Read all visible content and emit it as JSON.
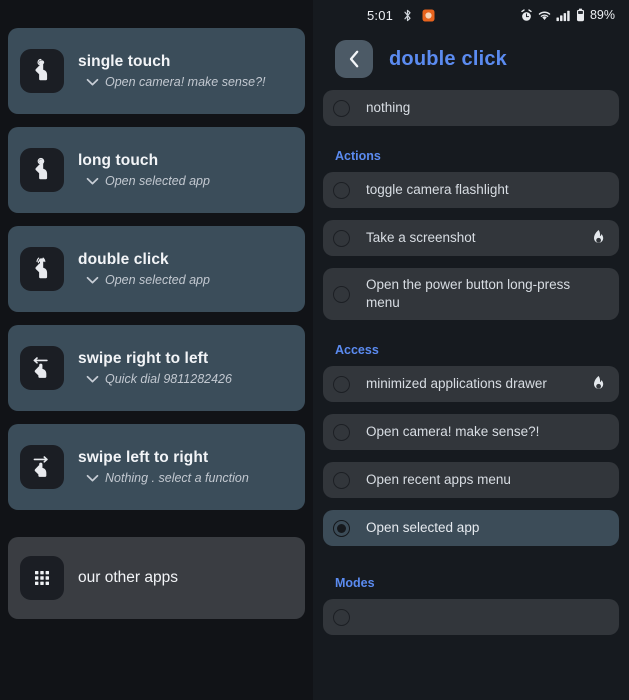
{
  "left_panel": {
    "cards": [
      {
        "icon": "single-touch-icon",
        "title": "single touch",
        "subtitle": "Open camera! make sense?!"
      },
      {
        "icon": "long-touch-icon",
        "title": "long touch",
        "subtitle": "Open selected app"
      },
      {
        "icon": "double-click-icon",
        "title": "double click",
        "subtitle": "Open selected app"
      },
      {
        "icon": "swipe-right-to-left-icon",
        "title": "swipe right to left",
        "subtitle": "Quick dial 9811282426"
      },
      {
        "icon": "swipe-left-to-right-icon",
        "title": "swipe left to right",
        "subtitle": "Nothing . select a function"
      }
    ],
    "other_apps": {
      "icon": "grid-apps-icon",
      "label": "our other apps"
    }
  },
  "right_panel": {
    "status_bar": {
      "clock": "5:01",
      "left_icons": [
        "bluetooth-icon",
        "app-notification-icon"
      ],
      "right_icons": [
        "alarm-icon",
        "wifi-icon",
        "signal-bars-icon",
        "battery-icon"
      ],
      "battery_percent": "89%"
    },
    "header": {
      "back_icon": "chevron-left-icon",
      "title": "double click"
    },
    "options": [
      {
        "label": "nothing",
        "selected": false,
        "flame": false,
        "two_line": false
      },
      {
        "section": "Actions"
      },
      {
        "label": "toggle camera flashlight",
        "selected": false,
        "flame": false,
        "two_line": false
      },
      {
        "label": "Take a screenshot",
        "selected": false,
        "flame": true,
        "two_line": false
      },
      {
        "label": "Open the power button long-press menu",
        "selected": false,
        "flame": false,
        "two_line": true
      },
      {
        "section": "Access"
      },
      {
        "label": "minimized applications drawer",
        "selected": false,
        "flame": true,
        "two_line": false
      },
      {
        "label": "Open camera! make sense?!",
        "selected": false,
        "flame": false,
        "two_line": false
      },
      {
        "label": "Open recent apps menu",
        "selected": false,
        "flame": false,
        "two_line": false
      },
      {
        "label": "Open selected app",
        "selected": true,
        "flame": false,
        "two_line": false
      },
      {
        "section": "Modes"
      }
    ]
  },
  "colors": {
    "background": "#111317",
    "card": "#3b4d5a",
    "card_alt": "#3a3d42",
    "accent_blue": "#5b8bf0",
    "row": "#32363b",
    "row_selected": "#3c4c58",
    "icon_tile": "#1b1e24"
  }
}
